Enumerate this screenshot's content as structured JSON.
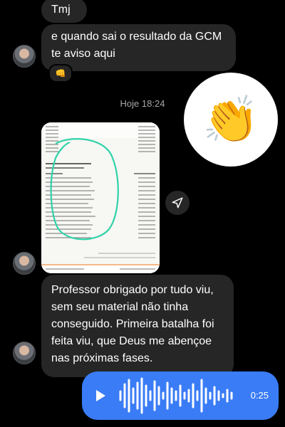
{
  "messages": {
    "m1": "Tmj",
    "m2": "e quando sai o resultado da GCM te aviso aqui",
    "m2_reaction": "👊",
    "timestamp": "Hoje 18:24",
    "sent_emoji": "👏",
    "m3": "Professor obrigado por tudo viu, sem seu material não tinha conseguido. Primeira batalha foi feita viu, que Deus me abençoe nas próximas fases.",
    "voice_duration": "0:25"
  },
  "colors": {
    "background": "#000000",
    "incoming_bubble": "#262626",
    "outgoing_voice": "#3a7cf6",
    "timestamp_text": "#a8a8a8"
  },
  "icons": {
    "avatar": "avatar",
    "share": "send-icon",
    "play": "play-icon",
    "waveform": "waveform-icon"
  }
}
